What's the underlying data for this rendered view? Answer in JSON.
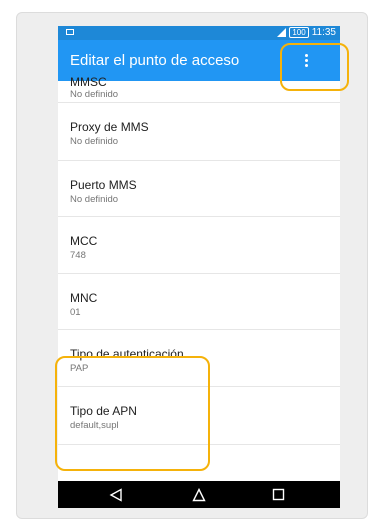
{
  "status_bar": {
    "battery": "100",
    "time": "11:35"
  },
  "app_bar": {
    "title": "Editar el punto de acceso"
  },
  "items": [
    {
      "title": "MMSC",
      "value": "No definido"
    },
    {
      "title": "Proxy de MMS",
      "value": "No definido"
    },
    {
      "title": "Puerto MMS",
      "value": "No definido"
    },
    {
      "title": "MCC",
      "value": "748"
    },
    {
      "title": "MNC",
      "value": "01"
    },
    {
      "title": "Tipo de autenticación",
      "value": "PAP"
    },
    {
      "title": "Tipo de APN",
      "value": "default,supl"
    }
  ],
  "nav_bar": {
    "icons": [
      "back-icon",
      "home-icon",
      "recents-icon"
    ]
  },
  "annotations": {
    "highlight_color": "#f5b20a"
  },
  "colors": {
    "status_bar": "#1e88d7",
    "app_bar": "#2196f3",
    "nav_bar": "#000000"
  }
}
